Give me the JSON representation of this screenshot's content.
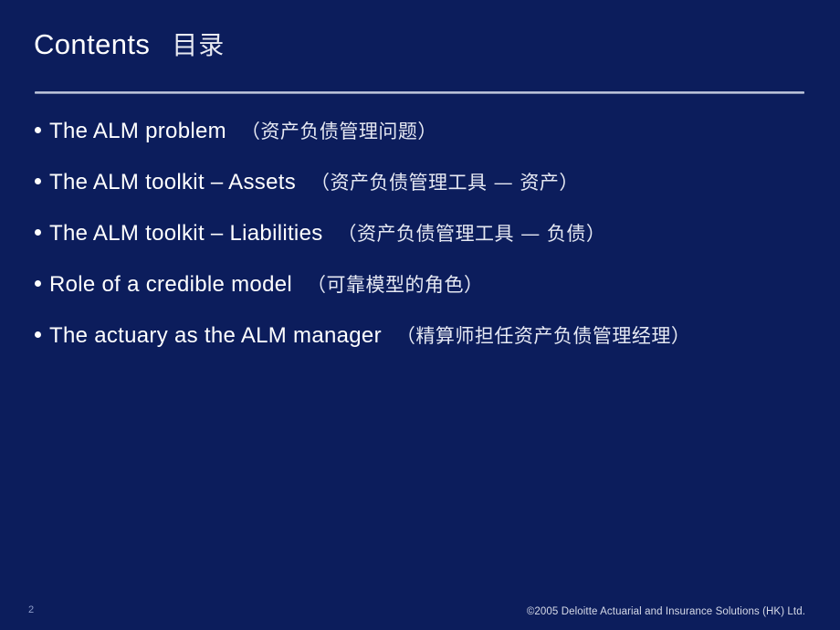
{
  "slide": {
    "background_color": "#0c1d5c",
    "title": {
      "english": "Contents",
      "chinese": "目录"
    },
    "bullets": [
      {
        "english": "The ALM problem",
        "chinese": "（资产负债管理问题）"
      },
      {
        "english": "The ALM toolkit – Assets",
        "chinese": "（资产负债管理工具 — 资产）"
      },
      {
        "english": "The ALM toolkit – Liabilities",
        "chinese": "（资产负债管理工具 — 负债）"
      },
      {
        "english": "Role of a credible model",
        "chinese": "（可靠模型的角色）"
      },
      {
        "english": "The actuary as the ALM manager",
        "chinese": "（精算师担任资产负债管理经理）"
      }
    ],
    "footer": {
      "page_number": "2",
      "copyright": "©2005 Deloitte Actuarial and Insurance Solutions (HK) Ltd."
    }
  }
}
